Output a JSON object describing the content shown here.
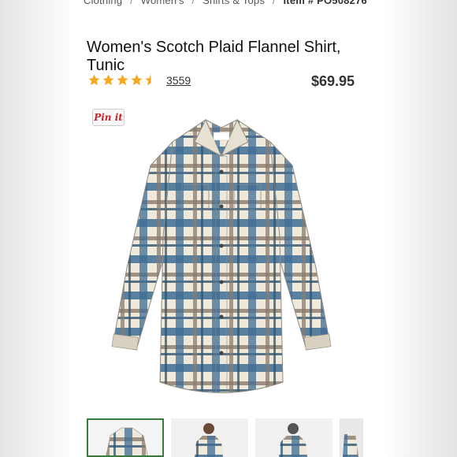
{
  "breadcrumb": {
    "items": [
      "Clothing",
      "Women's",
      "Shirts & Tops"
    ],
    "separator": "/",
    "item_number": "Item # PO508276"
  },
  "product": {
    "title": "Women's Scotch Plaid Flannel Shirt, Tunic",
    "rating": 4.5,
    "rating_max": 5,
    "review_count": "3559",
    "price": "$69.95"
  },
  "pinit": {
    "label": "Pin it"
  },
  "icons": {
    "star": "star-icon",
    "pin": "pinterest-icon"
  },
  "colors": {
    "star": "#f5a623",
    "active_thumb_border": "#3a7a3a",
    "pinit_text": "#c8232c"
  },
  "thumbnails": [
    {
      "name": "thumb-shirt-front",
      "active": true
    },
    {
      "name": "thumb-model-front",
      "active": false
    },
    {
      "name": "thumb-model-back",
      "active": false
    },
    {
      "name": "thumb-partial",
      "active": false
    }
  ]
}
